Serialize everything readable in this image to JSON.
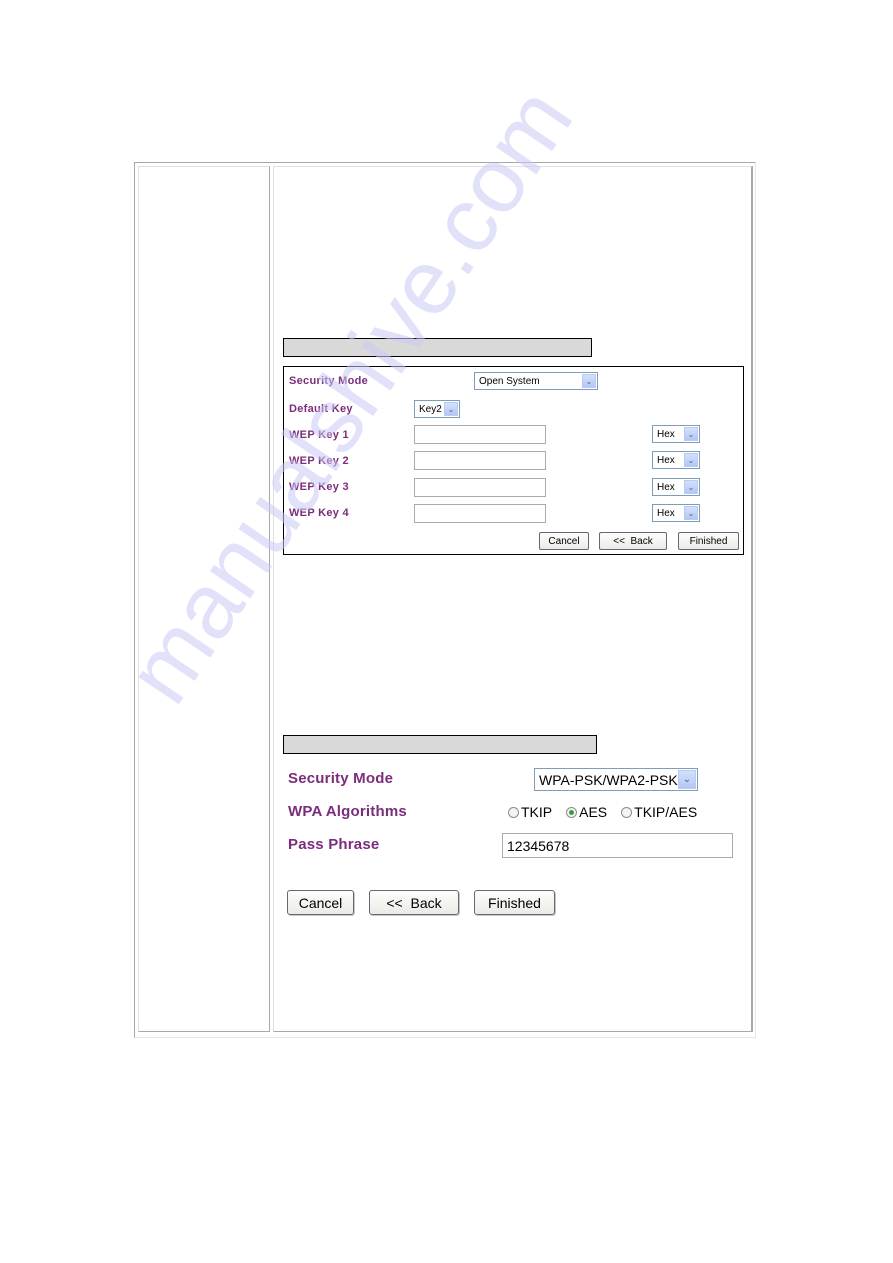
{
  "watermark": "manualshive.com",
  "wep_section": {
    "security_mode_label": "Security Mode",
    "security_mode_value": "Open System",
    "default_key_label": "Default Key",
    "default_key_value": "Key2",
    "wep_keys": [
      {
        "label": "WEP Key 1",
        "value": "",
        "format": "Hex"
      },
      {
        "label": "WEP Key 2",
        "value": "",
        "format": "Hex"
      },
      {
        "label": "WEP Key 3",
        "value": "",
        "format": "Hex"
      },
      {
        "label": "WEP Key 4",
        "value": "",
        "format": "Hex"
      }
    ],
    "buttons": {
      "cancel": "Cancel",
      "back": "<<  Back",
      "finished": "Finished"
    }
  },
  "wpa_section": {
    "security_mode_label": "Security Mode",
    "security_mode_value": "WPA-PSK/WPA2-PSK",
    "algorithms_label": "WPA Algorithms",
    "algorithms": [
      {
        "label": "TKIP",
        "selected": false
      },
      {
        "label": "AES",
        "selected": true
      },
      {
        "label": "TKIP/AES",
        "selected": false
      }
    ],
    "pass_phrase_label": "Pass Phrase",
    "pass_phrase_value": "12345678",
    "buttons": {
      "cancel": "Cancel",
      "back": "<<  Back",
      "finished": "Finished"
    }
  },
  "colors": {
    "label": "#7b2d7b",
    "header_bar": "#d9d9d9",
    "radio_selected": "#3b9d3b"
  }
}
